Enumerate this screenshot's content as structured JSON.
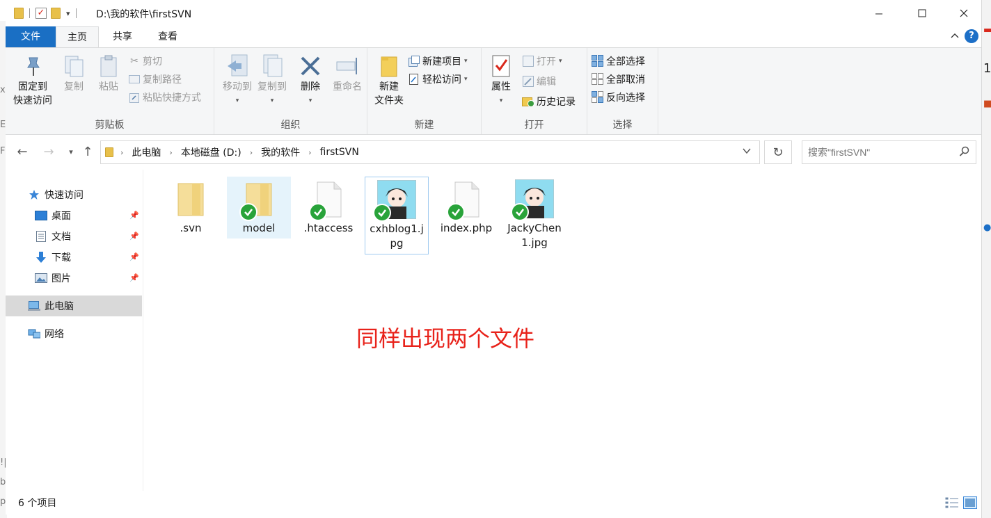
{
  "window": {
    "title": "D:\\我的软件\\firstSVN"
  },
  "tabs": [
    "文件",
    "主页",
    "共享",
    "查看"
  ],
  "help_label": "?",
  "ribbon": {
    "clipboard": {
      "label": "剪贴板",
      "pin_line1": "固定到",
      "pin_line2": "快速访问",
      "copy": "复制",
      "paste": "粘贴",
      "cut": "剪切",
      "copy_path": "复制路径",
      "paste_shortcut": "粘贴快捷方式"
    },
    "organize": {
      "label": "组织",
      "move_to": "移动到",
      "copy_to": "复制到",
      "delete": "删除",
      "rename": "重命名"
    },
    "new": {
      "label": "新建",
      "new_folder_line1": "新建",
      "new_folder_line2": "文件夹",
      "new_item": "新建项目",
      "easy_access": "轻松访问"
    },
    "open": {
      "label": "打开",
      "properties": "属性",
      "open": "打开",
      "edit": "编辑",
      "history": "历史记录"
    },
    "select": {
      "label": "选择",
      "select_all": "全部选择",
      "select_none": "全部取消",
      "invert": "反向选择"
    }
  },
  "address": {
    "crumbs": [
      "此电脑",
      "本地磁盘 (D:)",
      "我的软件",
      "firstSVN"
    ],
    "search_placeholder": "搜索\"firstSVN\""
  },
  "nav": {
    "quick_access": "快速访问",
    "desktop": "桌面",
    "documents": "文档",
    "downloads": "下载",
    "pictures": "图片",
    "this_pc": "此电脑",
    "network": "网络"
  },
  "files": [
    {
      "name": ".svn",
      "type": "folder",
      "badge": false
    },
    {
      "name": "model",
      "type": "folder",
      "badge": true
    },
    {
      "name": ".htaccess",
      "type": "file",
      "badge": true
    },
    {
      "name": "cxhblog1.jpg",
      "type": "image",
      "badge": true
    },
    {
      "name": "index.php",
      "type": "file",
      "badge": true
    },
    {
      "name": "JackyChen1.jpg",
      "type": "image",
      "badge": true
    }
  ],
  "annotation": "同样出现两个文件",
  "status": {
    "count": "6 个项目"
  },
  "colors": {
    "accent": "#1a6fc4",
    "ok_badge": "#29a33a",
    "annotation": "#e8221a"
  }
}
